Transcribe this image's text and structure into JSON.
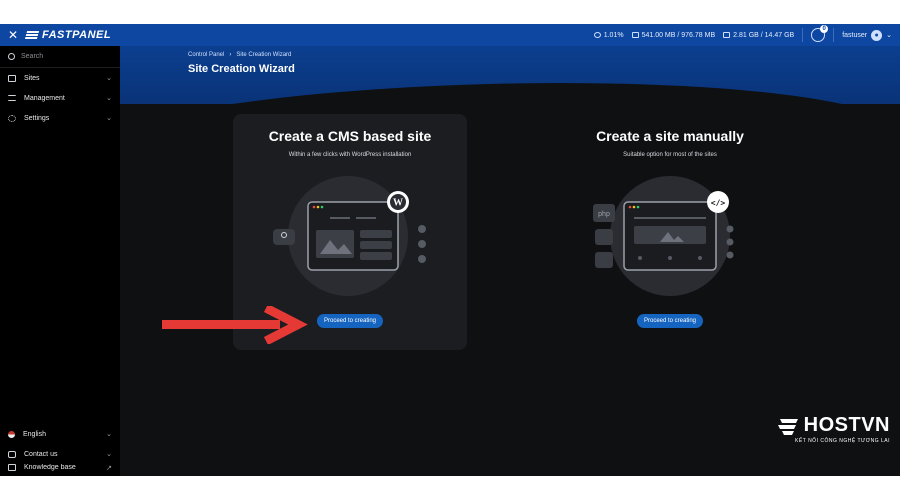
{
  "topbar": {
    "logo": "FASTPANEL",
    "cpu": "1.01%",
    "ram": "541.00 MB / 976.78 MB",
    "disk": "2.81 GB / 14.47 GB",
    "notifications": "0",
    "username": "fastuser"
  },
  "sidebar": {
    "search_placeholder": "Search",
    "items": [
      {
        "label": "Sites"
      },
      {
        "label": "Management"
      },
      {
        "label": "Settings"
      }
    ],
    "bottom_items": [
      {
        "label": "English"
      },
      {
        "label": "Contact us"
      },
      {
        "label": "Knowledge base"
      }
    ]
  },
  "header": {
    "breadcrumb": [
      "Control Panel",
      "Site Creation Wizard"
    ],
    "breadcrumb_sep": "›",
    "title": "Site Creation Wizard"
  },
  "cards": [
    {
      "title": "Create a CMS based site",
      "subtitle": "Within a few clicks with WordPress installation",
      "button": "Proceed to creating"
    },
    {
      "title": "Create a site manually",
      "subtitle": "Suitable option for most of the sites",
      "button": "Proceed to creating",
      "php_label": "php"
    }
  ],
  "brand": {
    "name": "HOSTVN",
    "tagline": "KẾT NỐI CÔNG NGHỆ TƯƠNG LAI"
  },
  "colors": {
    "accent": "#1565c0",
    "header": "#0d47a1",
    "arrow": "#e53935",
    "background": "#0f1012"
  }
}
